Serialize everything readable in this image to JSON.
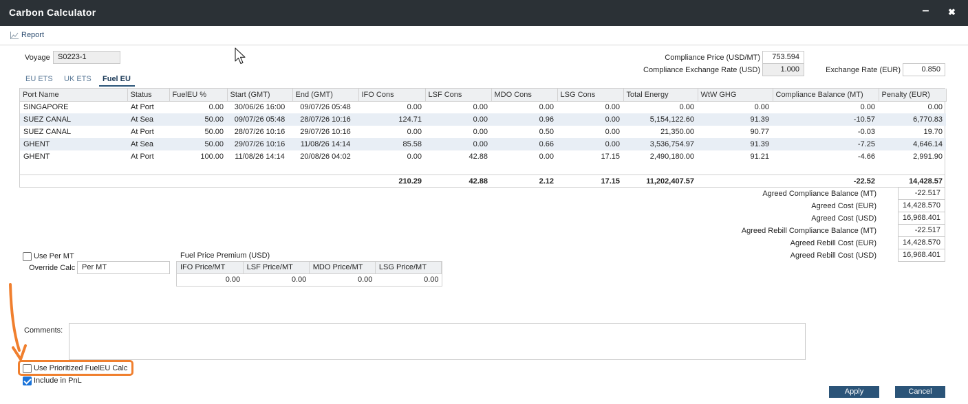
{
  "window": {
    "title": "Carbon Calculator",
    "minimize_glyph": "‒",
    "close_glyph": "✖"
  },
  "toolbar": {
    "report_label": "Report",
    "report_icon": "chart-line-icon"
  },
  "voyage": {
    "label": "Voyage",
    "value": "S0223-1"
  },
  "compliance": {
    "price_label": "Compliance Price (USD/MT)",
    "price_value": "753.594",
    "exch_label": "Compliance Exchange Rate (USD)",
    "exch_value": "1.000",
    "rate_label": "Exchange Rate (EUR)",
    "rate_value": "0.850"
  },
  "tabs": [
    {
      "label": "EU ETS",
      "active": false
    },
    {
      "label": "UK ETS",
      "active": false
    },
    {
      "label": "Fuel EU",
      "active": true
    }
  ],
  "grid": {
    "columns": [
      "Port Name",
      "Status",
      "FuelEU %",
      "Start (GMT)",
      "End (GMT)",
      "IFO Cons",
      "LSF Cons",
      "MDO Cons",
      "LSG Cons",
      "Total Energy",
      "WtW GHG",
      "Compliance Balance (MT)",
      "Penalty (EUR)"
    ],
    "rows": [
      [
        "SINGAPORE",
        "At Port",
        "0.00",
        "30/06/26 16:00",
        "09/07/26 05:48",
        "0.00",
        "0.00",
        "0.00",
        "0.00",
        "0.00",
        "0.00",
        "0.00",
        "0.00"
      ],
      [
        "SUEZ CANAL",
        "At Sea",
        "50.00",
        "09/07/26 05:48",
        "28/07/26 10:16",
        "124.71",
        "0.00",
        "0.96",
        "0.00",
        "5,154,122.60",
        "91.39",
        "-10.57",
        "6,770.83"
      ],
      [
        "SUEZ CANAL",
        "At Port",
        "50.00",
        "28/07/26 10:16",
        "29/07/26 10:16",
        "0.00",
        "0.00",
        "0.50",
        "0.00",
        "21,350.00",
        "90.77",
        "-0.03",
        "19.70"
      ],
      [
        "GHENT",
        "At Sea",
        "50.00",
        "29/07/26 10:16",
        "11/08/26 14:14",
        "85.58",
        "0.00",
        "0.66",
        "0.00",
        "3,536,754.97",
        "91.39",
        "-7.25",
        "4,646.14"
      ],
      [
        "GHENT",
        "At Port",
        "100.00",
        "11/08/26 14:14",
        "20/08/26 04:02",
        "0.00",
        "42.88",
        "0.00",
        "17.15",
        "2,490,180.00",
        "91.21",
        "-4.66",
        "2,991.90"
      ]
    ],
    "totals": [
      "",
      "",
      "",
      "",
      "",
      "210.29",
      "42.88",
      "2.12",
      "17.15",
      "11,202,407.57",
      "",
      "-22.52",
      "14,428.57"
    ]
  },
  "agreed": [
    {
      "label": "Agreed Compliance Balance (MT)",
      "value": "-22.517"
    },
    {
      "label": "Agreed Cost (EUR)",
      "value": "14,428.570"
    },
    {
      "label": "Agreed Cost (USD)",
      "value": "16,968.401"
    },
    {
      "label": "Agreed Rebill Compliance Balance (MT)",
      "value": "-22.517"
    },
    {
      "label": "Agreed Rebill Cost (EUR)",
      "value": "14,428.570"
    },
    {
      "label": "Agreed Rebill Cost (USD)",
      "value": "16,968.401"
    }
  ],
  "per_mt": {
    "use_label": "Use Per MT",
    "use_checked": false,
    "override_label": "Override Calc",
    "override_value": "Per MT"
  },
  "fuel_premium": {
    "title": "Fuel Price Premium (USD)",
    "columns": [
      "IFO Price/MT",
      "LSF Price/MT",
      "MDO Price/MT",
      "LSG Price/MT"
    ],
    "values": [
      "0.00",
      "0.00",
      "0.00",
      "0.00"
    ]
  },
  "comments": {
    "label": "Comments:",
    "value": ""
  },
  "options": {
    "prioritized_label": "Use Prioritized FuelEU Calc",
    "prioritized_checked": false,
    "pnl_label": "Include in PnL",
    "pnl_checked": true
  },
  "buttons": {
    "apply": "Apply",
    "cancel": "Cancel"
  },
  "colors": {
    "titlebar": "#2b3136",
    "accent": "#2b5478",
    "highlight": "#f07f2e",
    "row_alt": "#e8eef5"
  }
}
